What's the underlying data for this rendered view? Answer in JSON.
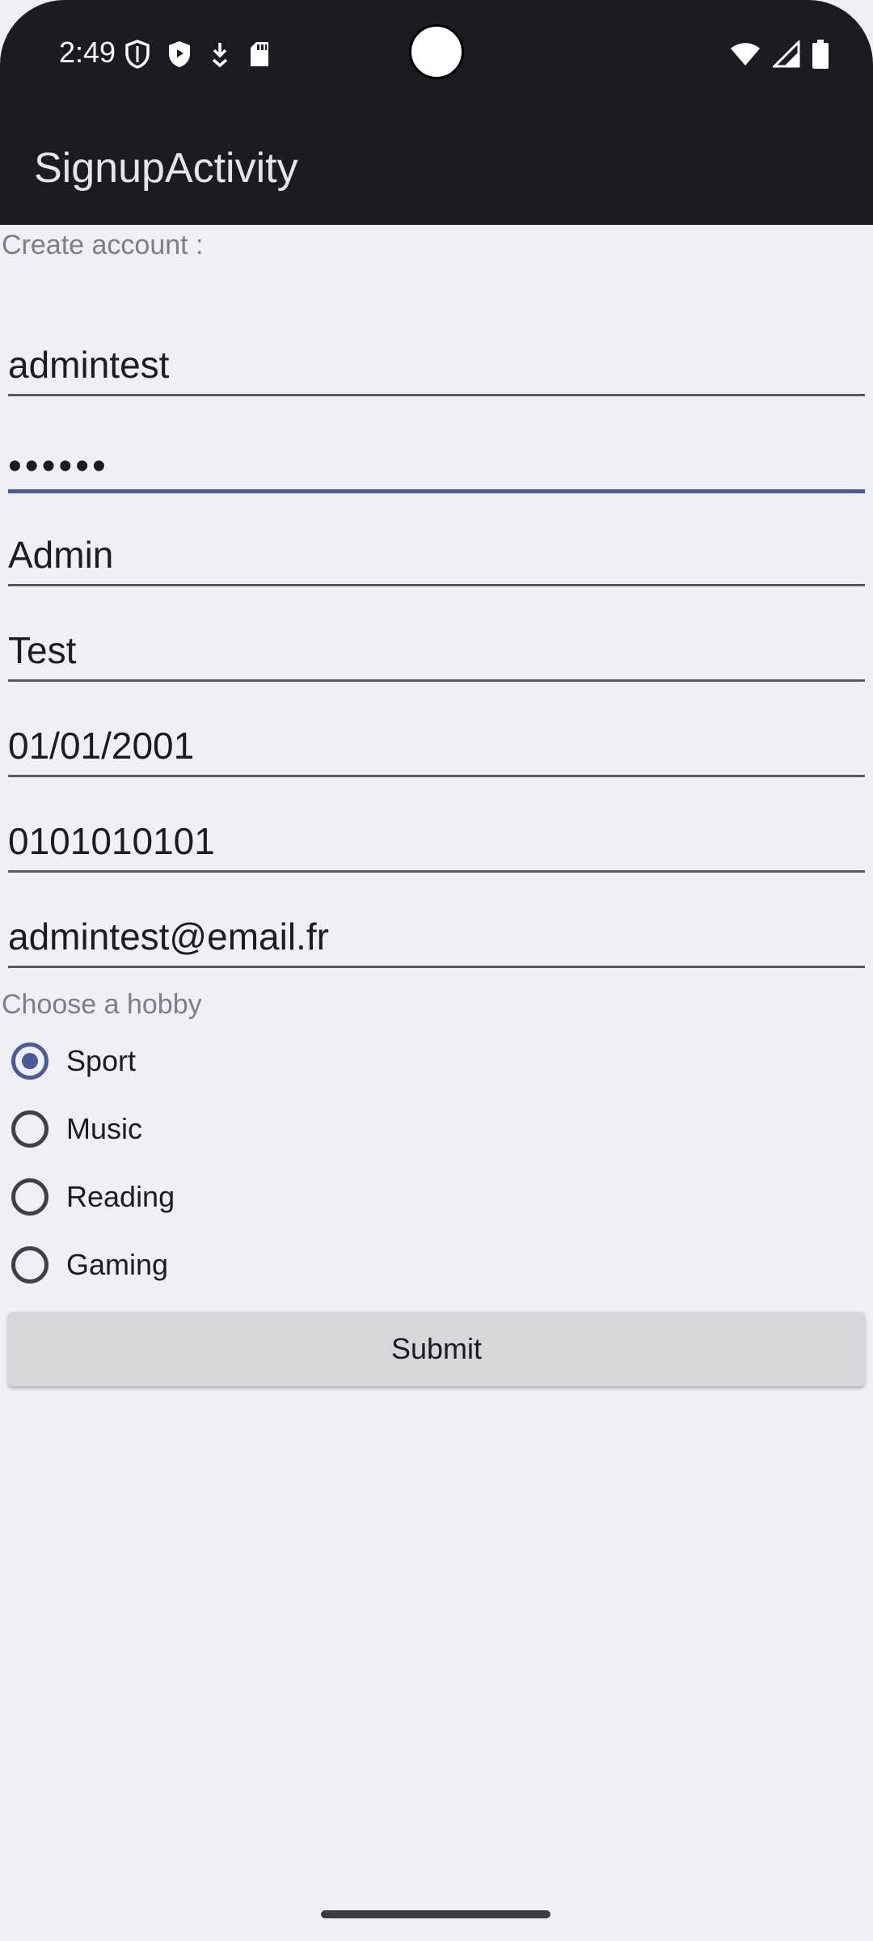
{
  "status_bar": {
    "time": "2:49",
    "left_icons": [
      "vpn-shield-outline-icon",
      "shield-icon",
      "download-icon",
      "sd-card-icon"
    ],
    "right_icons": [
      "wifi-icon",
      "signal-icon",
      "battery-icon"
    ]
  },
  "app_bar": {
    "title": "SignupActivity"
  },
  "form": {
    "header": "Create account :",
    "fields": [
      {
        "name": "username",
        "value": "admintest"
      },
      {
        "name": "password",
        "value": "••••••",
        "focused": true
      },
      {
        "name": "first-name",
        "value": "Admin"
      },
      {
        "name": "last-name",
        "value": "Test"
      },
      {
        "name": "birth-date",
        "value": "01/01/2001"
      },
      {
        "name": "phone",
        "value": "0101010101"
      },
      {
        "name": "email",
        "value": "admintest@email.fr"
      }
    ],
    "hobby_label": "Choose a hobby",
    "hobbies": [
      {
        "label": "Sport",
        "checked": true
      },
      {
        "label": "Music",
        "checked": false
      },
      {
        "label": "Reading",
        "checked": false
      },
      {
        "label": "Gaming",
        "checked": false
      }
    ],
    "submit_label": "Submit"
  },
  "colors": {
    "accent": "#4a5c98",
    "app_bar": "#1b1c21",
    "background": "#efeff5"
  }
}
